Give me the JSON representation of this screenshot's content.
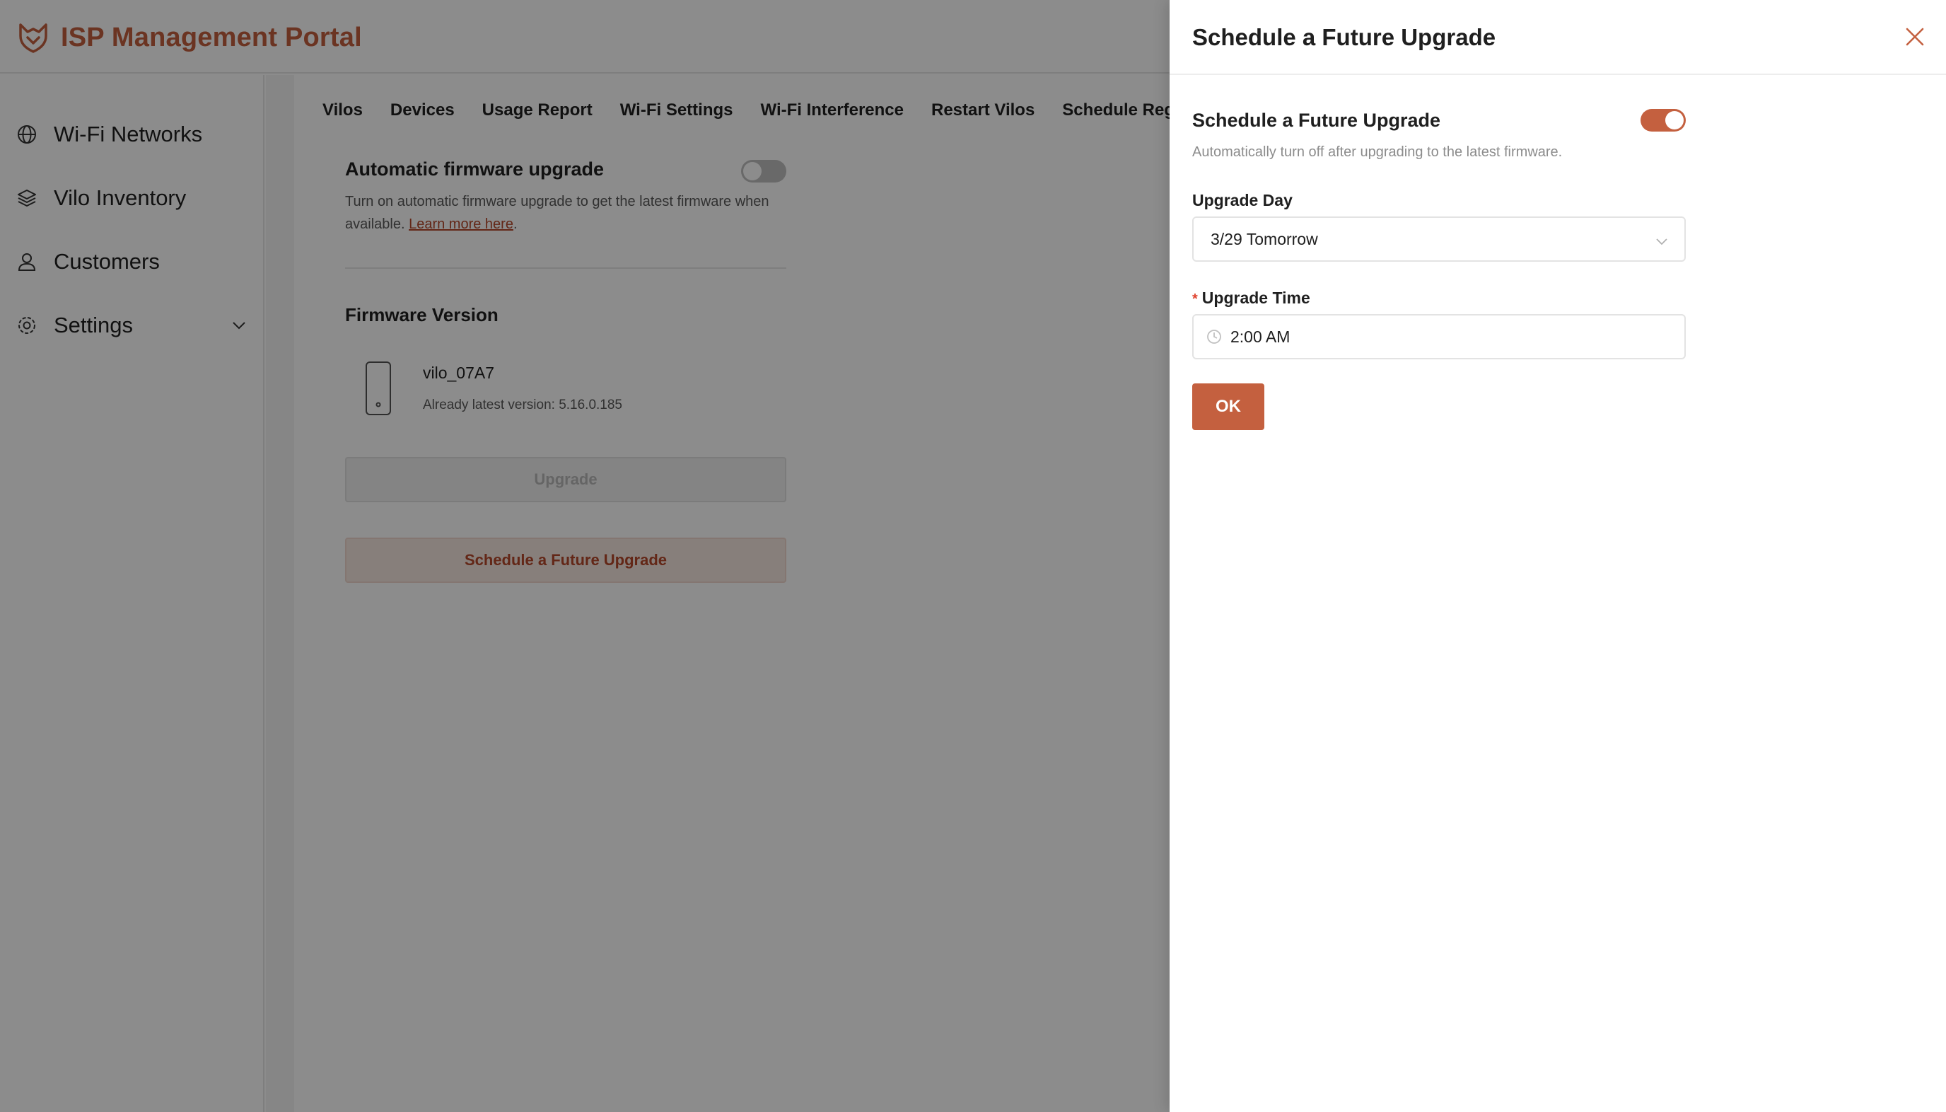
{
  "app": {
    "title": "ISP Management Portal",
    "brand_color": "#c4603f"
  },
  "sidebar": {
    "items": [
      {
        "label": "Wi-Fi Networks",
        "icon": "globe-icon"
      },
      {
        "label": "Vilo Inventory",
        "icon": "layers-icon"
      },
      {
        "label": "Customers",
        "icon": "user-icon"
      },
      {
        "label": "Settings",
        "icon": "gear-icon",
        "has_submenu": true
      }
    ],
    "collapse_icon": "menu-collapse-icon"
  },
  "tabs": [
    "Vilos",
    "Devices",
    "Usage Report",
    "Wi-Fi Settings",
    "Wi-Fi Interference",
    "Restart Vilos",
    "Schedule Regular Resta"
  ],
  "firmware": {
    "auto_upgrade_title": "Automatic firmware upgrade",
    "auto_upgrade_enabled": false,
    "auto_upgrade_desc": "Turn on automatic firmware upgrade to get the latest firmware when available.",
    "learn_more": "Learn more here",
    "version_title": "Firmware Version",
    "device_name": "vilo_07A7",
    "device_version": "Already latest version: 5.16.0.185",
    "upgrade_button": "Upgrade",
    "schedule_button": "Schedule a Future Upgrade"
  },
  "drawer": {
    "title": "Schedule a Future Upgrade",
    "toggle_label": "Schedule a Future Upgrade",
    "toggle_enabled": true,
    "toggle_desc": "Automatically turn off after upgrading to the latest firmware.",
    "day_label": "Upgrade Day",
    "day_value": "3/29 Tomorrow",
    "time_label": "Upgrade Time",
    "time_required_mark": "*",
    "time_value": "2:00 AM",
    "ok_button": "OK"
  }
}
